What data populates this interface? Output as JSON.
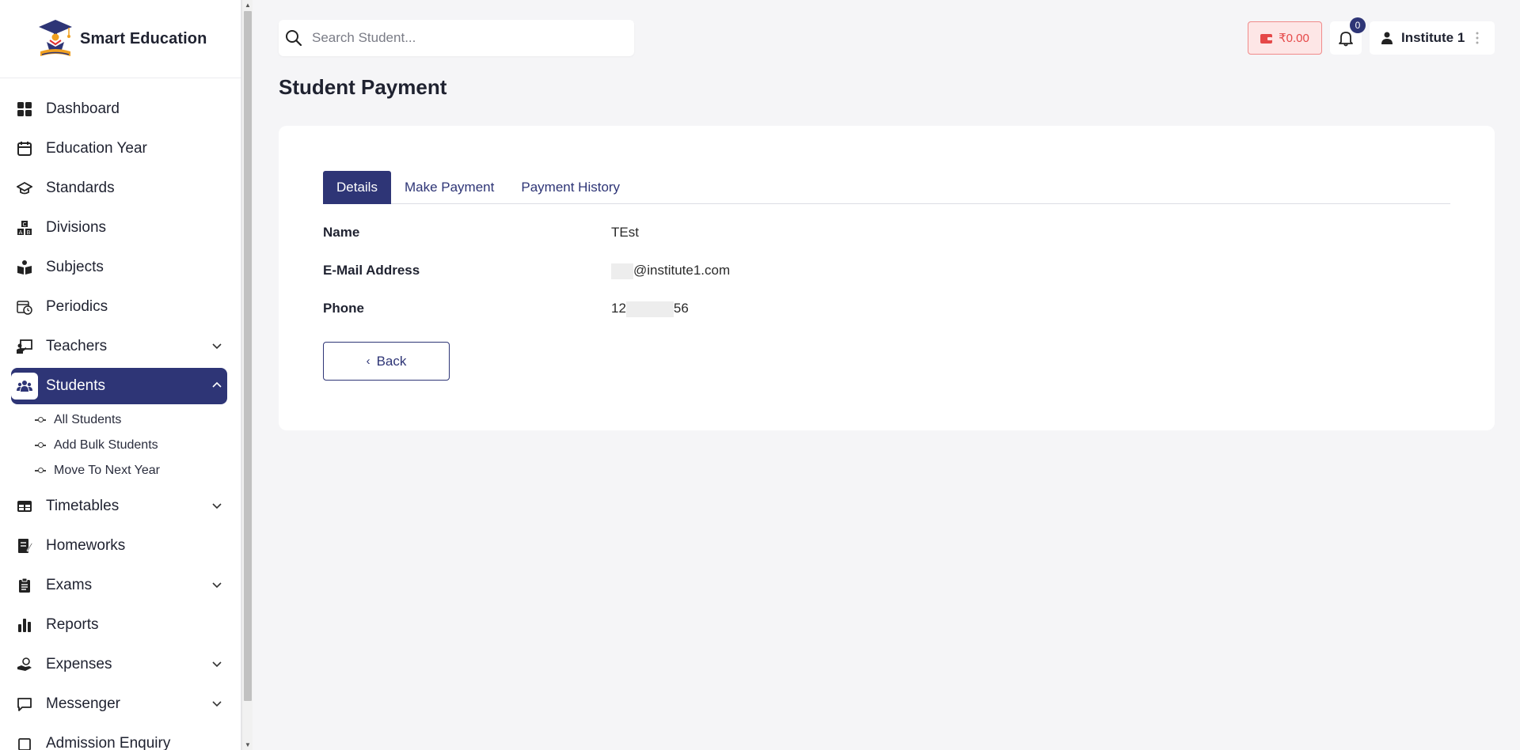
{
  "brand": {
    "name": "Smart Education"
  },
  "sidebar": {
    "items": [
      {
        "label": "Dashboard",
        "icon": "dashboard-icon"
      },
      {
        "label": "Education Year",
        "icon": "calendar-icon"
      },
      {
        "label": "Standards",
        "icon": "graduation-cap-icon"
      },
      {
        "label": "Divisions",
        "icon": "abc-blocks-icon"
      },
      {
        "label": "Subjects",
        "icon": "book-reader-icon"
      },
      {
        "label": "Periodics",
        "icon": "calendar-clock-icon"
      },
      {
        "label": "Teachers",
        "icon": "chalkboard-teacher-icon",
        "expandable": true
      },
      {
        "label": "Students",
        "icon": "users-icon",
        "expandable": true,
        "active": true
      },
      {
        "label": "Timetables",
        "icon": "table-icon",
        "expandable": true
      },
      {
        "label": "Homeworks",
        "icon": "notebook-pen-icon"
      },
      {
        "label": "Exams",
        "icon": "clipboard-icon",
        "expandable": true
      },
      {
        "label": "Reports",
        "icon": "bar-chart-icon"
      },
      {
        "label": "Expenses",
        "icon": "hand-money-icon",
        "expandable": true
      },
      {
        "label": "Messenger",
        "icon": "message-icon",
        "expandable": true
      },
      {
        "label": "Admission Enquiry",
        "icon": "enquiry-icon"
      }
    ],
    "students_sub": [
      "All Students",
      "Add Bulk Students",
      "Move To Next Year"
    ]
  },
  "search": {
    "placeholder": "Search Student..."
  },
  "wallet": {
    "amount": "₹0.00"
  },
  "notifications": {
    "count": "0"
  },
  "user": {
    "name": "Institute 1"
  },
  "page": {
    "title": "Student Payment"
  },
  "tabs": [
    "Details",
    "Make Payment",
    "Payment History"
  ],
  "details": {
    "name_label": "Name",
    "name_value": "TEst",
    "email_label": "E-Mail Address",
    "email_value": "@institute1.com",
    "phone_label": "Phone",
    "phone_prefix": "12",
    "phone_suffix": "56"
  },
  "back_button": {
    "label": "Back"
  },
  "colors": {
    "primary": "#2e3576",
    "wallet_text": "#e54848",
    "wallet_bg": "#fde6e6"
  }
}
